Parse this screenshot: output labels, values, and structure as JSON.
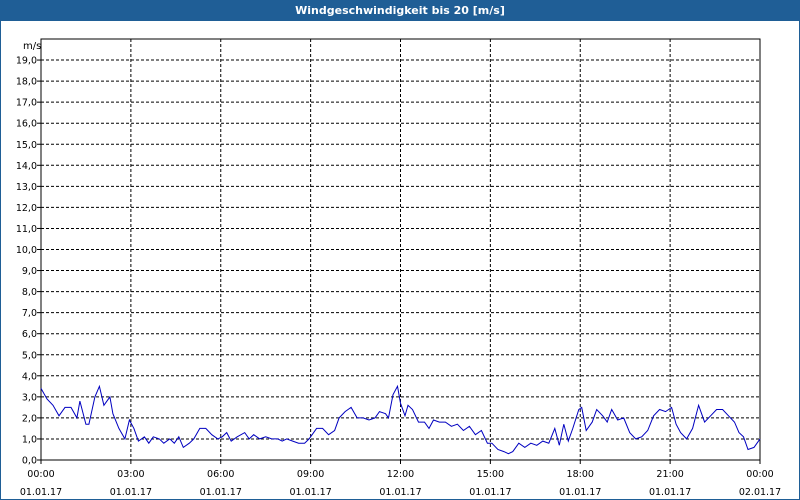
{
  "window": {
    "title": "Windgeschwindigkeit bis 20 [m/s]"
  },
  "colors": {
    "title_bar": "#1f5e96",
    "series": "#0000c0",
    "grid": "#000000"
  },
  "chart_data": {
    "type": "line",
    "title": "Windgeschwindigkeit bis 20 [m/s]",
    "ylabel": "m/s",
    "xlabel": "",
    "ylim": [
      0,
      20
    ],
    "xlim_hours": [
      0,
      24
    ],
    "grid": true,
    "y_ticks": [
      "0,0",
      "1,0",
      "2,0",
      "3,0",
      "4,0",
      "5,0",
      "6,0",
      "7,0",
      "8,0",
      "9,0",
      "10,0",
      "11,0",
      "12,0",
      "13,0",
      "14,0",
      "15,0",
      "16,0",
      "17,0",
      "18,0",
      "19,0"
    ],
    "x_ticks": [
      {
        "time": "00:00",
        "date": "01.01.17"
      },
      {
        "time": "03:00",
        "date": "01.01.17"
      },
      {
        "time": "06:00",
        "date": "01.01.17"
      },
      {
        "time": "09:00",
        "date": "01.01.17"
      },
      {
        "time": "12:00",
        "date": "01.01.17"
      },
      {
        "time": "15:00",
        "date": "01.01.17"
      },
      {
        "time": "18:00",
        "date": "01.01.17"
      },
      {
        "time": "21:00",
        "date": "01.01.17"
      },
      {
        "time": "00:00",
        "date": "02.01.17"
      }
    ],
    "series": [
      {
        "points": [
          [
            0.0,
            3.4
          ],
          [
            0.2,
            2.9
          ],
          [
            0.4,
            2.6
          ],
          [
            0.6,
            2.1
          ],
          [
            0.8,
            2.5
          ],
          [
            1.0,
            2.5
          ],
          [
            1.2,
            2.0
          ],
          [
            1.3,
            2.8
          ],
          [
            1.5,
            1.7
          ],
          [
            1.6,
            1.7
          ],
          [
            1.8,
            3.0
          ],
          [
            1.95,
            3.5
          ],
          [
            2.1,
            2.6
          ],
          [
            2.3,
            3.0
          ],
          [
            2.4,
            2.2
          ],
          [
            2.6,
            1.5
          ],
          [
            2.8,
            1.0
          ],
          [
            2.95,
            1.9
          ],
          [
            3.1,
            1.5
          ],
          [
            3.25,
            0.9
          ],
          [
            3.45,
            1.1
          ],
          [
            3.6,
            0.8
          ],
          [
            3.75,
            1.1
          ],
          [
            3.95,
            1.0
          ],
          [
            4.1,
            0.8
          ],
          [
            4.3,
            1.0
          ],
          [
            4.45,
            0.8
          ],
          [
            4.6,
            1.1
          ],
          [
            4.75,
            0.6
          ],
          [
            4.95,
            0.8
          ],
          [
            5.1,
            1.0
          ],
          [
            5.3,
            1.5
          ],
          [
            5.5,
            1.5
          ],
          [
            5.7,
            1.2
          ],
          [
            5.9,
            1.0
          ],
          [
            6.05,
            1.1
          ],
          [
            6.2,
            1.3
          ],
          [
            6.35,
            0.9
          ],
          [
            6.55,
            1.1
          ],
          [
            6.8,
            1.3
          ],
          [
            6.95,
            1.0
          ],
          [
            7.1,
            1.2
          ],
          [
            7.3,
            1.0
          ],
          [
            7.5,
            1.1
          ],
          [
            7.7,
            1.0
          ],
          [
            7.9,
            1.0
          ],
          [
            8.05,
            0.9
          ],
          [
            8.2,
            1.0
          ],
          [
            8.4,
            0.9
          ],
          [
            8.6,
            0.8
          ],
          [
            8.8,
            0.8
          ],
          [
            8.95,
            1.0
          ],
          [
            9.2,
            1.5
          ],
          [
            9.4,
            1.5
          ],
          [
            9.6,
            1.2
          ],
          [
            9.8,
            1.4
          ],
          [
            9.95,
            2.0
          ],
          [
            10.15,
            2.3
          ],
          [
            10.35,
            2.5
          ],
          [
            10.55,
            2.0
          ],
          [
            10.75,
            2.0
          ],
          [
            10.95,
            1.9
          ],
          [
            11.15,
            2.0
          ],
          [
            11.3,
            2.3
          ],
          [
            11.5,
            2.2
          ],
          [
            11.6,
            2.0
          ],
          [
            11.75,
            3.1
          ],
          [
            11.9,
            3.5
          ],
          [
            12.0,
            2.7
          ],
          [
            12.15,
            2.1
          ],
          [
            12.25,
            2.6
          ],
          [
            12.4,
            2.4
          ],
          [
            12.6,
            1.8
          ],
          [
            12.8,
            1.8
          ],
          [
            12.95,
            1.5
          ],
          [
            13.1,
            1.9
          ],
          [
            13.3,
            1.8
          ],
          [
            13.5,
            1.8
          ],
          [
            13.7,
            1.6
          ],
          [
            13.9,
            1.7
          ],
          [
            14.1,
            1.4
          ],
          [
            14.3,
            1.6
          ],
          [
            14.5,
            1.2
          ],
          [
            14.7,
            1.4
          ],
          [
            14.9,
            0.8
          ],
          [
            15.05,
            0.8
          ],
          [
            15.25,
            0.5
          ],
          [
            15.45,
            0.4
          ],
          [
            15.6,
            0.3
          ],
          [
            15.75,
            0.4
          ],
          [
            15.95,
            0.8
          ],
          [
            16.15,
            0.6
          ],
          [
            16.35,
            0.8
          ],
          [
            16.55,
            0.7
          ],
          [
            16.75,
            0.9
          ],
          [
            16.95,
            0.8
          ],
          [
            17.15,
            1.5
          ],
          [
            17.3,
            0.7
          ],
          [
            17.45,
            1.7
          ],
          [
            17.6,
            0.9
          ],
          [
            17.75,
            1.5
          ],
          [
            17.95,
            2.4
          ],
          [
            18.05,
            2.5
          ],
          [
            18.2,
            1.4
          ],
          [
            18.4,
            1.8
          ],
          [
            18.55,
            2.4
          ],
          [
            18.75,
            2.1
          ],
          [
            18.9,
            1.8
          ],
          [
            19.05,
            2.4
          ],
          [
            19.25,
            1.9
          ],
          [
            19.45,
            2.0
          ],
          [
            19.65,
            1.3
          ],
          [
            19.85,
            1.0
          ],
          [
            20.05,
            1.1
          ],
          [
            20.25,
            1.4
          ],
          [
            20.45,
            2.1
          ],
          [
            20.65,
            2.4
          ],
          [
            20.85,
            2.3
          ],
          [
            21.05,
            2.5
          ],
          [
            21.2,
            1.7
          ],
          [
            21.35,
            1.3
          ],
          [
            21.55,
            1.0
          ],
          [
            21.75,
            1.5
          ],
          [
            21.95,
            2.6
          ],
          [
            22.15,
            1.8
          ],
          [
            22.35,
            2.1
          ],
          [
            22.55,
            2.4
          ],
          [
            22.75,
            2.4
          ],
          [
            22.95,
            2.1
          ],
          [
            23.15,
            1.8
          ],
          [
            23.3,
            1.3
          ],
          [
            23.45,
            1.1
          ],
          [
            23.6,
            0.5
          ],
          [
            23.8,
            0.6
          ],
          [
            24.0,
            1.0
          ]
        ]
      }
    ]
  }
}
